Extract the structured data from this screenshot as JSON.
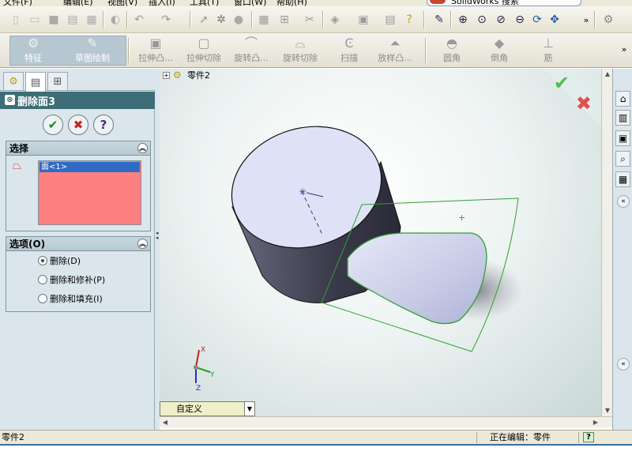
{
  "menubar": {
    "items": [
      "文件(F)",
      "编辑(E)",
      "视图(V)",
      "插入(I)",
      "工具(T)",
      "窗口(W)",
      "帮助(H)"
    ],
    "search_text": "SolidWorks 搜索"
  },
  "standard_toolbar": {
    "icons": [
      "new-icon",
      "open-icon",
      "save-icon",
      "print-icon",
      "rebuild-icon",
      "options-icon",
      "undo-icon",
      "redo-icon",
      "select-icon",
      "smart-dimension-icon",
      "point-icon",
      "grid-icon",
      "snap-icon",
      "tools-icon",
      "view-cube-icon",
      "display-style-icon",
      "layers-icon",
      "help-icon",
      "sketch-icon",
      "zoom-fit-icon",
      "zoom-area-icon",
      "zoom-in-out-icon",
      "zoom-selection-icon",
      "rotate-icon",
      "pan-icon"
    ]
  },
  "command_manager": {
    "tabs": [
      {
        "label": "特征",
        "icon": "feature-icon",
        "active": true
      },
      {
        "label": "草图绘制",
        "icon": "sketch-icon",
        "active": true
      }
    ],
    "items": [
      {
        "label": "拉伸凸...",
        "icon": "extrude-boss-icon"
      },
      {
        "label": "拉伸切除",
        "icon": "extrude-cut-icon"
      },
      {
        "label": "旋转凸...",
        "icon": "revolve-boss-icon"
      },
      {
        "label": "旋转切除",
        "icon": "revolve-cut-icon"
      },
      {
        "label": "扫描",
        "icon": "sweep-icon"
      },
      {
        "label": "放样凸...",
        "icon": "loft-icon"
      },
      {
        "label": "圆角",
        "icon": "fillet-icon"
      },
      {
        "label": "倒角",
        "icon": "chamfer-icon"
      },
      {
        "label": "筋",
        "icon": "rib-icon"
      }
    ]
  },
  "property_manager": {
    "title": "删除面3",
    "buttons": {
      "ok": "✔",
      "cancel": "✖",
      "help": "?"
    },
    "selection": {
      "header": "选择",
      "items": [
        "面<1>"
      ]
    },
    "options": {
      "header": "选项(O)",
      "choices": [
        {
          "label": "删除(D)",
          "selected": true
        },
        {
          "label": "删除和修补(P)",
          "selected": false
        },
        {
          "label": "删除和填充(I)",
          "selected": false
        }
      ]
    }
  },
  "graphics": {
    "tree_label": "零件2",
    "view_orientation": "自定义",
    "triad": {
      "x": "X",
      "y": "Y",
      "z": "Z"
    }
  },
  "status_bar": {
    "left": "零件2",
    "right": "正在编辑：零件",
    "help": "?"
  },
  "colors": {
    "selection_pink": "#ff8080",
    "pm_title": "#3d6d76",
    "face_highlight": "#2fa02f"
  }
}
